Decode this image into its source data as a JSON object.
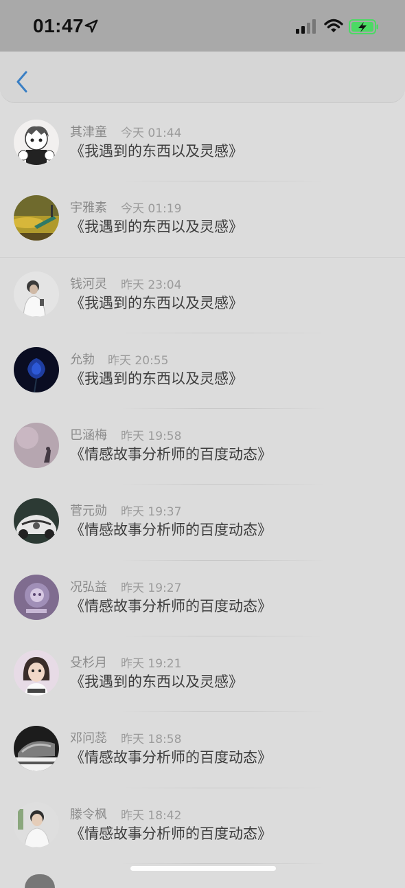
{
  "status_bar": {
    "time": "01:47",
    "icons": [
      "location-arrow-icon",
      "cellular-signal-icon",
      "wifi-icon",
      "battery-charging-icon"
    ],
    "battery_color": "#4cd964"
  },
  "nav": {
    "back_icon": "chevron-left-icon",
    "accent": "#3a7fc4"
  },
  "messages": [
    {
      "name": "其津童",
      "time": "今天 01:44",
      "content": "《我遇到的东西以及灵感》"
    },
    {
      "name": "宇雅素",
      "time": "今天 01:19",
      "content": "《我遇到的东西以及灵感》"
    },
    {
      "name": "钱河灵",
      "time": "昨天 23:04",
      "content": "《我遇到的东西以及灵感》"
    },
    {
      "name": "允勃",
      "time": "昨天 20:55",
      "content": "《我遇到的东西以及灵感》"
    },
    {
      "name": "巴涵梅",
      "time": "昨天 19:58",
      "content": "《情感故事分析师的百度动态》"
    },
    {
      "name": "菅元勋",
      "time": "昨天 19:37",
      "content": "《情感故事分析师的百度动态》"
    },
    {
      "name": "况弘益",
      "time": "昨天 19:27",
      "content": "《情感故事分析师的百度动态》"
    },
    {
      "name": "殳杉月",
      "time": "昨天 19:21",
      "content": "《我遇到的东西以及灵感》"
    },
    {
      "name": "邓问蕊",
      "time": "昨天 18:58",
      "content": "《情感故事分析师的百度动态》"
    },
    {
      "name": "滕令枫",
      "time": "昨天 18:42",
      "content": "《情感故事分析师的百度动态》"
    }
  ]
}
